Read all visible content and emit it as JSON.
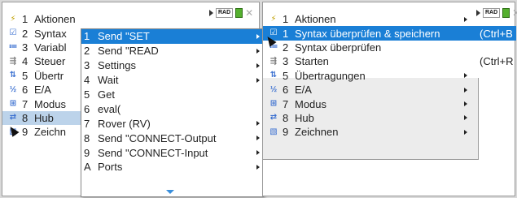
{
  "left": {
    "status": {
      "mode": "RAD"
    },
    "menu": [
      {
        "num": "1",
        "label": "Aktionen",
        "icon": "lightning-icon",
        "glyph": "⚡",
        "color": "#c0a000"
      },
      {
        "num": "2",
        "label": "Syntax",
        "icon": "check-icon",
        "glyph": "☑",
        "color": "#3a6fd0"
      },
      {
        "num": "3",
        "label": "Variabl",
        "icon": "variables-icon",
        "glyph": "≔",
        "color": "#3a6fd0"
      },
      {
        "num": "4",
        "label": "Steuer",
        "icon": "control-icon",
        "glyph": "⇶",
        "color": "#7a7a7a"
      },
      {
        "num": "5",
        "label": "Übertr",
        "icon": "transfer-icon",
        "glyph": "⇅",
        "color": "#3a6fd0"
      },
      {
        "num": "6",
        "label": "E/A",
        "icon": "io-icon",
        "glyph": "½",
        "color": "#3a6fd0"
      },
      {
        "num": "7",
        "label": "Modus",
        "icon": "mode-icon",
        "glyph": "⊞",
        "color": "#3a6fd0"
      },
      {
        "num": "8",
        "label": "Hub",
        "icon": "hub-icon",
        "glyph": "⇄",
        "color": "#3a6fd0"
      },
      {
        "num": "9",
        "label": "Zeichn",
        "icon": "draw-icon",
        "glyph": "▧",
        "color": "#3a6fd0"
      }
    ],
    "submenu": [
      {
        "num": "1",
        "label": "Send \"SET",
        "arrow": true
      },
      {
        "num": "2",
        "label": "Send \"READ",
        "arrow": true
      },
      {
        "num": "3",
        "label": "Settings",
        "arrow": true
      },
      {
        "num": "4",
        "label": "Wait",
        "arrow": true
      },
      {
        "num": "5",
        "label": "Get",
        "arrow": false
      },
      {
        "num": "6",
        "label": "eval(",
        "arrow": false
      },
      {
        "num": "7",
        "label": "Rover (RV)",
        "arrow": true
      },
      {
        "num": "8",
        "label": "Send \"CONNECT-Output",
        "arrow": true
      },
      {
        "num": "9",
        "label": "Send \"CONNECT-Input",
        "arrow": true
      },
      {
        "num": "A",
        "label": "Ports",
        "arrow": true
      }
    ]
  },
  "right": {
    "status": {
      "mode": "RAD"
    },
    "menu": [
      {
        "num": "1",
        "label": "Aktionen",
        "icon": "lightning-icon",
        "glyph": "⚡",
        "color": "#c0a000",
        "arrow": true,
        "shortcut": ""
      },
      {
        "num": "1",
        "label": "Syntax überprüfen & speichern",
        "icon": "check-icon",
        "glyph": "☑",
        "color": "#ffffff",
        "arrow": false,
        "shortcut": "(Ctrl+B"
      },
      {
        "num": "2",
        "label": "Syntax überprüfen",
        "icon": "variables-icon",
        "glyph": "≔",
        "color": "#3a6fd0",
        "arrow": false,
        "shortcut": ""
      },
      {
        "num": "3",
        "label": "Starten",
        "icon": "control-icon",
        "glyph": "⇶",
        "color": "#7a7a7a",
        "arrow": false,
        "shortcut": "(Ctrl+R"
      },
      {
        "num": "5",
        "label": "Übertragungen",
        "icon": "transfer-icon",
        "glyph": "⇅",
        "color": "#3a6fd0",
        "arrow": true,
        "shortcut": ""
      },
      {
        "num": "6",
        "label": "E/A",
        "icon": "io-icon",
        "glyph": "½",
        "color": "#3a6fd0",
        "arrow": true,
        "shortcut": ""
      },
      {
        "num": "7",
        "label": "Modus",
        "icon": "mode-icon",
        "glyph": "⊞",
        "color": "#3a6fd0",
        "arrow": true,
        "shortcut": ""
      },
      {
        "num": "8",
        "label": "Hub",
        "icon": "hub-icon",
        "glyph": "⇄",
        "color": "#3a6fd0",
        "arrow": true,
        "shortcut": ""
      },
      {
        "num": "9",
        "label": "Zeichnen",
        "icon": "draw-icon",
        "glyph": "▧",
        "color": "#3a6fd0",
        "arrow": true,
        "shortcut": ""
      }
    ]
  }
}
